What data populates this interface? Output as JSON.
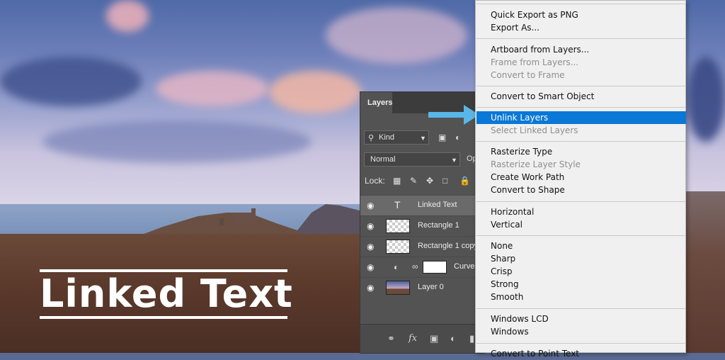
{
  "canvas": {
    "text": "Linked Text"
  },
  "layers_panel": {
    "tab": "Layers",
    "filter": {
      "label": "Kind"
    },
    "blend_mode": "Normal",
    "opacity_label": "Op",
    "lock_label": "Lock:",
    "layers": [
      {
        "name": "Linked Text",
        "kind": "text",
        "selected": true
      },
      {
        "name": "Rectangle 1",
        "kind": "shape",
        "selected": false
      },
      {
        "name": "Rectangle 1 copy",
        "kind": "shape",
        "selected": false
      },
      {
        "name": "Curves",
        "kind": "adjustment",
        "selected": false
      },
      {
        "name": "Layer 0",
        "kind": "image",
        "selected": false
      }
    ],
    "bottom_icons": [
      "link-icon",
      "fx-icon",
      "mask-icon",
      "adjustment-icon"
    ],
    "fx_label": "fx"
  },
  "context_menu": {
    "items": [
      {
        "label": "Quick Export as PNG",
        "disabled": false
      },
      {
        "label": "Export As...",
        "disabled": false
      },
      {
        "label": "Artboard from Layers...",
        "disabled": false
      },
      {
        "label": "Frame from Layers...",
        "disabled": true
      },
      {
        "label": "Convert to Frame",
        "disabled": true
      },
      {
        "label": "Convert to Smart Object",
        "disabled": false
      },
      {
        "label": "Unlink Layers",
        "disabled": false,
        "highlighted": true
      },
      {
        "label": "Select Linked Layers",
        "disabled": true
      },
      {
        "label": "Rasterize Type",
        "disabled": false
      },
      {
        "label": "Rasterize Layer Style",
        "disabled": true
      },
      {
        "label": "Create Work Path",
        "disabled": false
      },
      {
        "label": "Convert to Shape",
        "disabled": false
      },
      {
        "label": "Horizontal",
        "disabled": false
      },
      {
        "label": "Vertical",
        "disabled": false
      },
      {
        "label": "None",
        "disabled": false
      },
      {
        "label": "Sharp",
        "disabled": false
      },
      {
        "label": "Crisp",
        "disabled": false
      },
      {
        "label": "Strong",
        "disabled": false
      },
      {
        "label": "Smooth",
        "disabled": false
      },
      {
        "label": "Windows LCD",
        "disabled": false
      },
      {
        "label": "Windows",
        "disabled": false
      },
      {
        "label": "Convert to Point Text",
        "disabled": false
      }
    ],
    "highlight_color": "#0a78d7"
  },
  "colors": {
    "panel_bg": "#535353",
    "menu_bg": "#f0f0f0",
    "arrow": "#59b7e8"
  }
}
